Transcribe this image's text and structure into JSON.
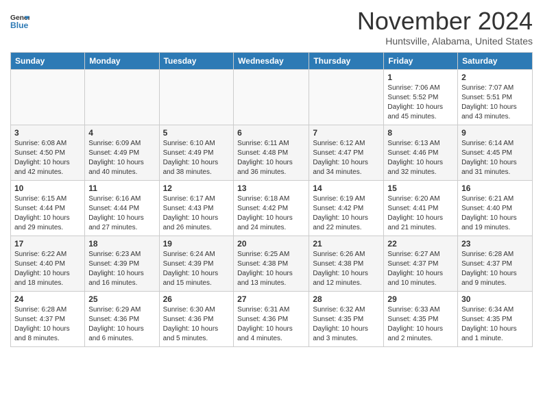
{
  "header": {
    "logo_line1": "General",
    "logo_line2": "Blue",
    "month_title": "November 2024",
    "subtitle": "Huntsville, Alabama, United States"
  },
  "days_of_week": [
    "Sunday",
    "Monday",
    "Tuesday",
    "Wednesday",
    "Thursday",
    "Friday",
    "Saturday"
  ],
  "weeks": [
    [
      {
        "day": "",
        "info": ""
      },
      {
        "day": "",
        "info": ""
      },
      {
        "day": "",
        "info": ""
      },
      {
        "day": "",
        "info": ""
      },
      {
        "day": "",
        "info": ""
      },
      {
        "day": "1",
        "info": "Sunrise: 7:06 AM\nSunset: 5:52 PM\nDaylight: 10 hours and 45 minutes."
      },
      {
        "day": "2",
        "info": "Sunrise: 7:07 AM\nSunset: 5:51 PM\nDaylight: 10 hours and 43 minutes."
      }
    ],
    [
      {
        "day": "3",
        "info": "Sunrise: 6:08 AM\nSunset: 4:50 PM\nDaylight: 10 hours and 42 minutes."
      },
      {
        "day": "4",
        "info": "Sunrise: 6:09 AM\nSunset: 4:49 PM\nDaylight: 10 hours and 40 minutes."
      },
      {
        "day": "5",
        "info": "Sunrise: 6:10 AM\nSunset: 4:49 PM\nDaylight: 10 hours and 38 minutes."
      },
      {
        "day": "6",
        "info": "Sunrise: 6:11 AM\nSunset: 4:48 PM\nDaylight: 10 hours and 36 minutes."
      },
      {
        "day": "7",
        "info": "Sunrise: 6:12 AM\nSunset: 4:47 PM\nDaylight: 10 hours and 34 minutes."
      },
      {
        "day": "8",
        "info": "Sunrise: 6:13 AM\nSunset: 4:46 PM\nDaylight: 10 hours and 32 minutes."
      },
      {
        "day": "9",
        "info": "Sunrise: 6:14 AM\nSunset: 4:45 PM\nDaylight: 10 hours and 31 minutes."
      }
    ],
    [
      {
        "day": "10",
        "info": "Sunrise: 6:15 AM\nSunset: 4:44 PM\nDaylight: 10 hours and 29 minutes."
      },
      {
        "day": "11",
        "info": "Sunrise: 6:16 AM\nSunset: 4:44 PM\nDaylight: 10 hours and 27 minutes."
      },
      {
        "day": "12",
        "info": "Sunrise: 6:17 AM\nSunset: 4:43 PM\nDaylight: 10 hours and 26 minutes."
      },
      {
        "day": "13",
        "info": "Sunrise: 6:18 AM\nSunset: 4:42 PM\nDaylight: 10 hours and 24 minutes."
      },
      {
        "day": "14",
        "info": "Sunrise: 6:19 AM\nSunset: 4:42 PM\nDaylight: 10 hours and 22 minutes."
      },
      {
        "day": "15",
        "info": "Sunrise: 6:20 AM\nSunset: 4:41 PM\nDaylight: 10 hours and 21 minutes."
      },
      {
        "day": "16",
        "info": "Sunrise: 6:21 AM\nSunset: 4:40 PM\nDaylight: 10 hours and 19 minutes."
      }
    ],
    [
      {
        "day": "17",
        "info": "Sunrise: 6:22 AM\nSunset: 4:40 PM\nDaylight: 10 hours and 18 minutes."
      },
      {
        "day": "18",
        "info": "Sunrise: 6:23 AM\nSunset: 4:39 PM\nDaylight: 10 hours and 16 minutes."
      },
      {
        "day": "19",
        "info": "Sunrise: 6:24 AM\nSunset: 4:39 PM\nDaylight: 10 hours and 15 minutes."
      },
      {
        "day": "20",
        "info": "Sunrise: 6:25 AM\nSunset: 4:38 PM\nDaylight: 10 hours and 13 minutes."
      },
      {
        "day": "21",
        "info": "Sunrise: 6:26 AM\nSunset: 4:38 PM\nDaylight: 10 hours and 12 minutes."
      },
      {
        "day": "22",
        "info": "Sunrise: 6:27 AM\nSunset: 4:37 PM\nDaylight: 10 hours and 10 minutes."
      },
      {
        "day": "23",
        "info": "Sunrise: 6:28 AM\nSunset: 4:37 PM\nDaylight: 10 hours and 9 minutes."
      }
    ],
    [
      {
        "day": "24",
        "info": "Sunrise: 6:28 AM\nSunset: 4:37 PM\nDaylight: 10 hours and 8 minutes."
      },
      {
        "day": "25",
        "info": "Sunrise: 6:29 AM\nSunset: 4:36 PM\nDaylight: 10 hours and 6 minutes."
      },
      {
        "day": "26",
        "info": "Sunrise: 6:30 AM\nSunset: 4:36 PM\nDaylight: 10 hours and 5 minutes."
      },
      {
        "day": "27",
        "info": "Sunrise: 6:31 AM\nSunset: 4:36 PM\nDaylight: 10 hours and 4 minutes."
      },
      {
        "day": "28",
        "info": "Sunrise: 6:32 AM\nSunset: 4:35 PM\nDaylight: 10 hours and 3 minutes."
      },
      {
        "day": "29",
        "info": "Sunrise: 6:33 AM\nSunset: 4:35 PM\nDaylight: 10 hours and 2 minutes."
      },
      {
        "day": "30",
        "info": "Sunrise: 6:34 AM\nSunset: 4:35 PM\nDaylight: 10 hours and 1 minute."
      }
    ]
  ]
}
